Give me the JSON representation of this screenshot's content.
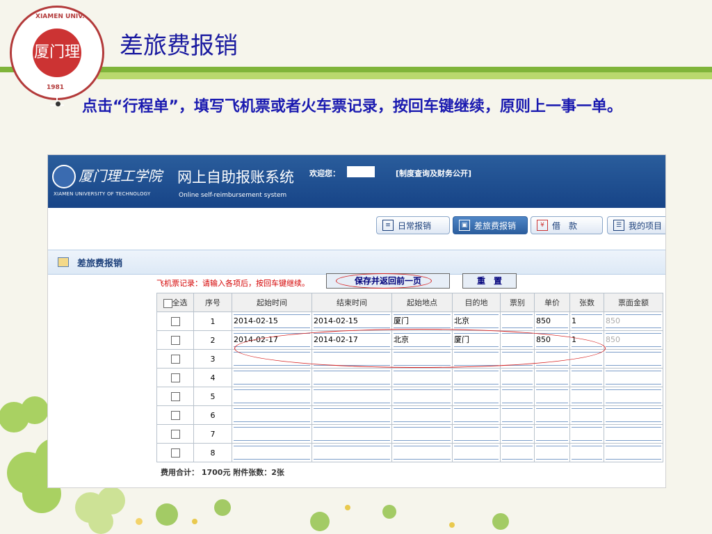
{
  "slide": {
    "title": "差旅费报销",
    "bullet": "点击“行程单”，填写飞机票或者火车票记录，按回车键继续，原则上一事一单。",
    "logo": {
      "center_text": "厦门理工",
      "ring_text": "XIAMEN UNIVERSITY OF TECHNOLOGY",
      "year": "1981"
    }
  },
  "app": {
    "school_name": "厦门理工学院",
    "school_name_en": "XIAMEN UNIVERSITY OF TECHNOLOGY",
    "title": "网上自助报账系统",
    "title_en": "Online self-reimbursement system",
    "welcome": "欢迎您：",
    "links": "[制度查询及财务公开]"
  },
  "toolbar": {
    "items": [
      {
        "label": "日常报销",
        "icon": "document-icon"
      },
      {
        "label": "差旅费报销",
        "icon": "vehicle-icon",
        "active": true
      },
      {
        "label": "借　款",
        "icon": "loan-icon"
      },
      {
        "label": "我的项目",
        "icon": "list-icon"
      }
    ]
  },
  "section": {
    "title": "差旅费报销"
  },
  "form": {
    "hint": "飞机票记录：请输入各项后，按回车键继续。",
    "save_button": "保存并返回前一页",
    "reset_button": "重　置",
    "select_all": "全选",
    "columns": [
      "序号",
      "起始时间",
      "结束时间",
      "起始地点",
      "目的地",
      "票别",
      "单价",
      "张数",
      "票面金额"
    ],
    "rows": [
      {
        "no": "1",
        "start": "2014-02-15",
        "end": "2014-02-15",
        "from": "厦门",
        "to": "北京",
        "type": "",
        "price": "850",
        "count": "1",
        "amount": "850"
      },
      {
        "no": "2",
        "start": "2014-02-17",
        "end": "2014-02-17",
        "from": "北京",
        "to": "厦门",
        "type": "",
        "price": "850",
        "count": "1",
        "amount": "850"
      },
      {
        "no": "3",
        "start": "",
        "end": "",
        "from": "",
        "to": "",
        "type": "",
        "price": "",
        "count": "",
        "amount": ""
      },
      {
        "no": "4",
        "start": "",
        "end": "",
        "from": "",
        "to": "",
        "type": "",
        "price": "",
        "count": "",
        "amount": ""
      },
      {
        "no": "5",
        "start": "",
        "end": "",
        "from": "",
        "to": "",
        "type": "",
        "price": "",
        "count": "",
        "amount": ""
      },
      {
        "no": "6",
        "start": "",
        "end": "",
        "from": "",
        "to": "",
        "type": "",
        "price": "",
        "count": "",
        "amount": ""
      },
      {
        "no": "7",
        "start": "",
        "end": "",
        "from": "",
        "to": "",
        "type": "",
        "price": "",
        "count": "",
        "amount": ""
      },
      {
        "no": "8",
        "start": "",
        "end": "",
        "from": "",
        "to": "",
        "type": "",
        "price": "",
        "count": "",
        "amount": ""
      }
    ],
    "total": "费用合计：  1700元   附件张数：2张"
  },
  "colors": {
    "title": "#1a1aa0",
    "header_blue": "#174487",
    "green_bar": "#7fb43a",
    "hint_red": "#d40000",
    "annotation_red": "#d62020"
  }
}
